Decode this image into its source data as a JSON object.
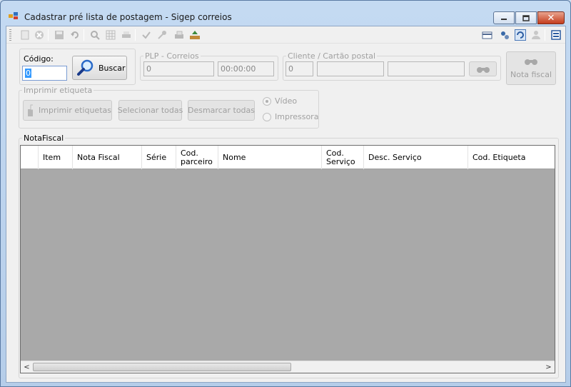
{
  "window": {
    "title": "Cadastrar pré lista de postagem - Sigep correios"
  },
  "toolbar": {
    "icons_left": [
      "edit-icon",
      "cancel-icon",
      "save-icon",
      "undo-icon",
      "search-icon",
      "grid-icon",
      "print-icon",
      "check-icon",
      "key-icon",
      "printer-icon",
      "export-icon"
    ],
    "icons_right": [
      "card-icon",
      "config-icon",
      "refresh-icon",
      "user-icon",
      "window-icon"
    ]
  },
  "search": {
    "label": "Código:",
    "value": "0",
    "button_label": "Buscar"
  },
  "plp": {
    "legend": "PLP - Correios",
    "number": "0",
    "time": "00:00:00"
  },
  "cliente": {
    "legend": "Cliente / Cartão postal",
    "code": "0",
    "name": "",
    "card": ""
  },
  "nota_fiscal_button": "Nota fiscal",
  "imprimir": {
    "legend": "Imprimir etiqueta",
    "print_button": "Imprimir etiquetas",
    "select_all_button": "Selecionar todas",
    "deselect_all_button": "Desmarcar todas",
    "radio_video": "Vídeo",
    "radio_printer": "Impressora"
  },
  "nota_fiscal_group": {
    "legend": "NotaFiscal"
  },
  "table": {
    "columns": [
      "",
      "Item",
      "Nota Fiscal",
      "Série",
      "Cod. parceiro",
      "Nome",
      "Cod. Serviço",
      "Desc. Serviço",
      "Cod. Etiqueta"
    ]
  },
  "colors": {
    "grid_background": "#a9a9a9",
    "selection": "#3399ff",
    "close_button": "#c43c1c"
  }
}
